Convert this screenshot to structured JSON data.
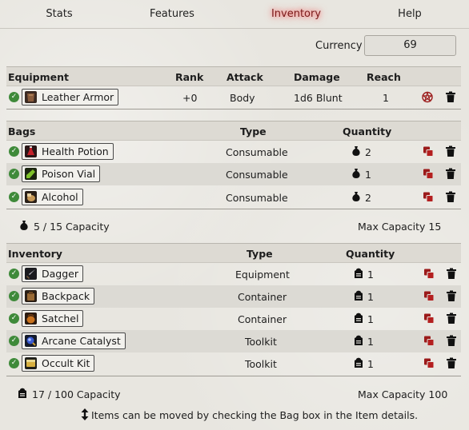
{
  "nav": {
    "tabs": [
      {
        "label": "Stats"
      },
      {
        "label": "Features"
      },
      {
        "label": "Inventory"
      },
      {
        "label": "Help"
      }
    ]
  },
  "currency": {
    "label": "Currency",
    "value": "69"
  },
  "equipment": {
    "headers": {
      "name": "Equipment",
      "rank": "Rank",
      "attack": "Attack",
      "damage": "Damage",
      "reach": "Reach"
    },
    "items": [
      {
        "name": "Leather Armor",
        "rank": "+0",
        "attack": "Body",
        "damage": "1d6 Blunt",
        "reach": "1",
        "icon": "leather-armor-icon"
      }
    ]
  },
  "bags": {
    "headers": {
      "name": "Bags",
      "type": "Type",
      "quantity": "Quantity"
    },
    "items": [
      {
        "name": "Health Potion",
        "type": "Consumable",
        "quantity": "2",
        "icon": "health-potion-icon"
      },
      {
        "name": "Poison Vial",
        "type": "Consumable",
        "quantity": "1",
        "icon": "poison-vial-icon"
      },
      {
        "name": "Alcohol",
        "type": "Consumable",
        "quantity": "2",
        "icon": "alcohol-icon"
      }
    ],
    "capacity": "5 / 15 Capacity",
    "max_capacity": "Max Capacity 15"
  },
  "inventory": {
    "headers": {
      "name": "Inventory",
      "type": "Type",
      "quantity": "Quantity"
    },
    "items": [
      {
        "name": "Dagger",
        "type": "Equipment",
        "quantity": "1",
        "icon": "dagger-icon"
      },
      {
        "name": "Backpack",
        "type": "Container",
        "quantity": "1",
        "icon": "backpack-icon"
      },
      {
        "name": "Satchel",
        "type": "Container",
        "quantity": "1",
        "icon": "satchel-icon"
      },
      {
        "name": "Arcane Catalyst",
        "type": "Toolkit",
        "quantity": "1",
        "icon": "arcane-catalyst-icon"
      },
      {
        "name": "Occult Kit",
        "type": "Toolkit",
        "quantity": "1",
        "icon": "occult-kit-icon"
      }
    ],
    "capacity": "17 / 100 Capacity",
    "max_capacity": "Max Capacity 100"
  },
  "footer": {
    "note": "Items can be moved by checking the Bag box in the Item details."
  },
  "colors": {
    "accent_red": "#8b1a1a",
    "check_green": "#3f8a3a",
    "active_tab_glow": "#ff5050"
  }
}
